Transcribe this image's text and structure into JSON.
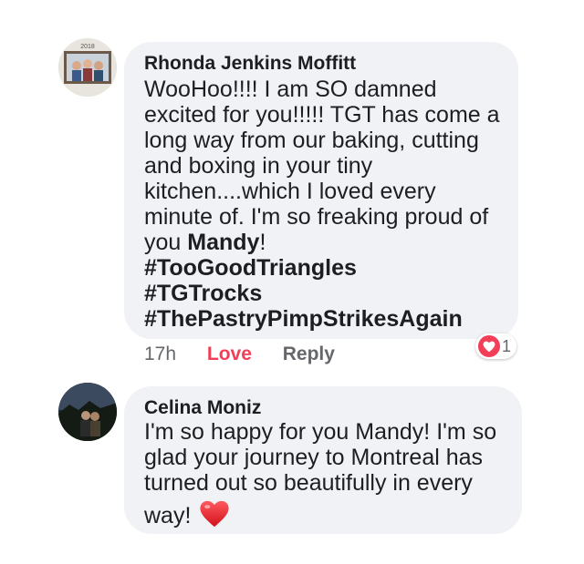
{
  "comments": [
    {
      "author": "Rhonda Jenkins Moffitt",
      "avatar_caption": "2018",
      "lines": [
        [
          "WooHoo!!!! I am SO damned"
        ],
        [
          "excited for you!!!!! TGT has come a"
        ],
        [
          "long way from our baking, cutting"
        ],
        [
          "and boxing in your tiny"
        ],
        [
          "kitchen....which I loved every"
        ],
        [
          "minute of. I'm so freaking proud of"
        ],
        [
          "you ",
          "Mandy",
          "!"
        ],
        [
          "#TooGoodTriangles"
        ],
        [
          "#TGTrocks"
        ],
        [
          "#ThePastryPimpStrikesAgain"
        ]
      ],
      "time": "17h",
      "love_label": "Love",
      "reply_label": "Reply",
      "reaction_count": "1"
    },
    {
      "author": "Celina Moniz",
      "lines": [
        [
          "I'm so happy for you Mandy!  I'm so"
        ],
        [
          "glad your journey to Montreal has"
        ],
        [
          "turned out so beautifully in every"
        ],
        [
          "way!"
        ]
      ],
      "emoji": "heart-emoji"
    }
  ],
  "colors": {
    "bubble": "#f1f2f5",
    "love": "#f33e58",
    "meta": "#65676b"
  }
}
